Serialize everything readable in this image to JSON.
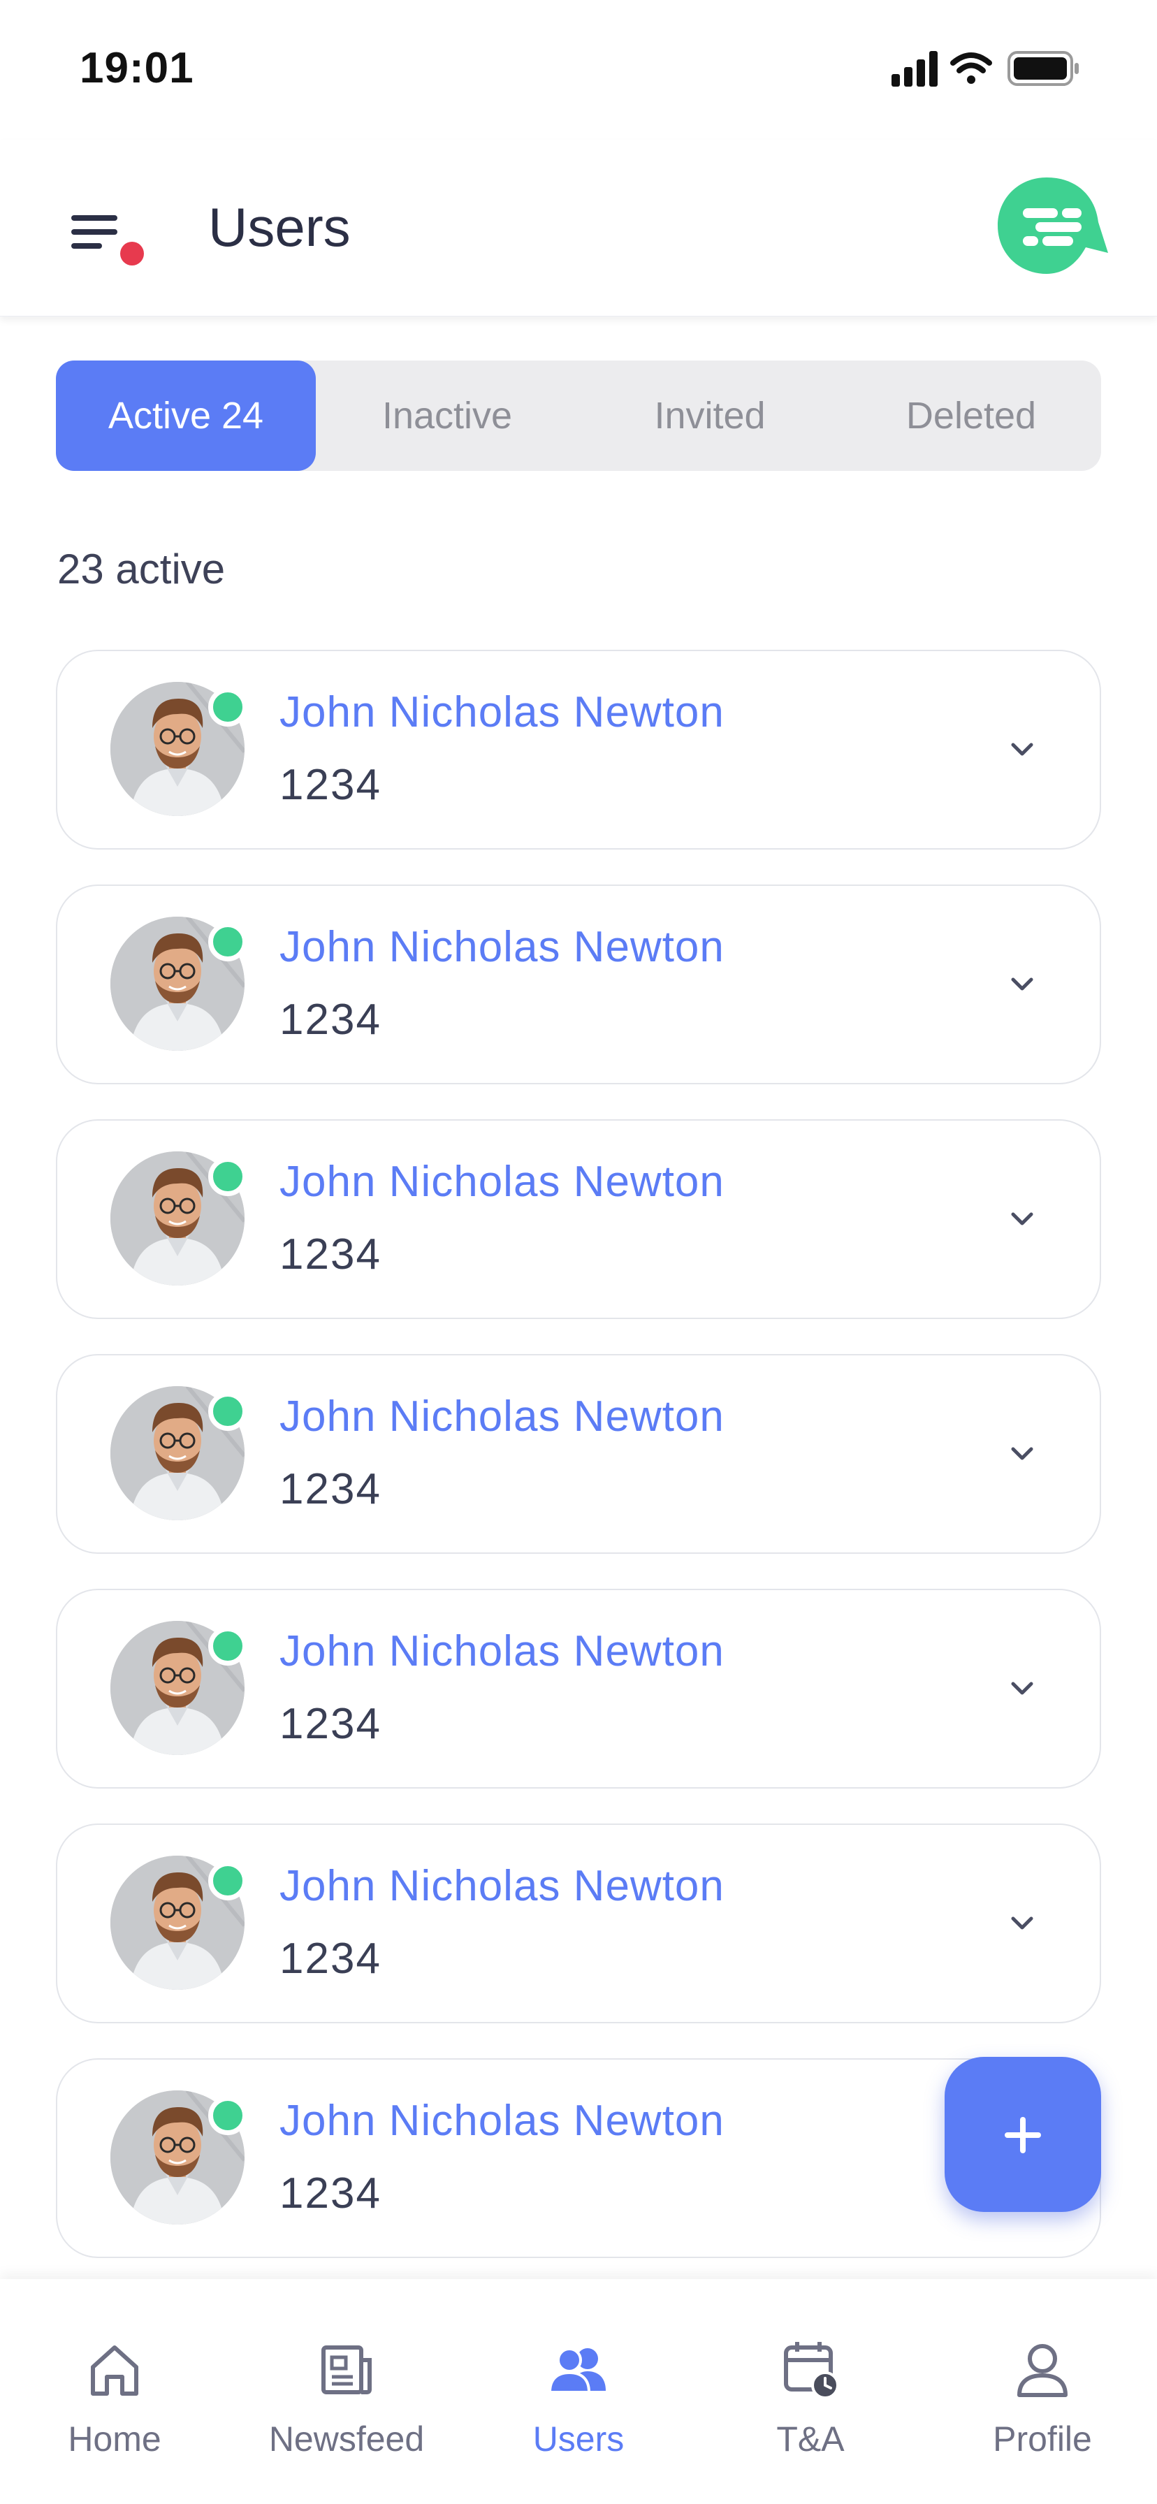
{
  "status_bar": {
    "time": "19:01",
    "signal_icon": "signal-icon",
    "wifi_icon": "wifi-icon",
    "battery_icon": "battery-icon"
  },
  "header": {
    "title": "Users",
    "menu_icon": "menu-icon",
    "chat_icon": "chat-icon",
    "notification_dot_color": "#e73a4e"
  },
  "tabs": [
    {
      "label": "Active 24",
      "active": true
    },
    {
      "label": "Inactive",
      "active": false
    },
    {
      "label": "Invited",
      "active": false
    },
    {
      "label": "Deleted",
      "active": false
    }
  ],
  "summary": {
    "count_label": "23 active"
  },
  "users": [
    {
      "name": "John Nicholas Newton",
      "id": "1234",
      "online": true
    },
    {
      "name": "John Nicholas Newton",
      "id": "1234",
      "online": true
    },
    {
      "name": "John Nicholas Newton",
      "id": "1234",
      "online": true
    },
    {
      "name": "John Nicholas Newton",
      "id": "1234",
      "online": true
    },
    {
      "name": "John Nicholas Newton",
      "id": "1234",
      "online": true
    },
    {
      "name": "John Nicholas Newton",
      "id": "1234",
      "online": true
    },
    {
      "name": "John Nicholas Newton",
      "id": "1234",
      "online": true
    }
  ],
  "fab": {
    "icon": "plus-icon"
  },
  "bottom_nav": [
    {
      "label": "Home",
      "icon": "home-icon",
      "active": false
    },
    {
      "label": "Newsfeed",
      "icon": "newsfeed-icon",
      "active": false
    },
    {
      "label": "Users",
      "icon": "users-icon",
      "active": true
    },
    {
      "label": "T&A",
      "icon": "time-attendance-icon",
      "active": false
    },
    {
      "label": "Profile",
      "icon": "profile-icon",
      "active": false
    }
  ],
  "colors": {
    "accent": "#5b7cf5",
    "online": "#3fd191",
    "brand_chat": "#3fd191"
  }
}
